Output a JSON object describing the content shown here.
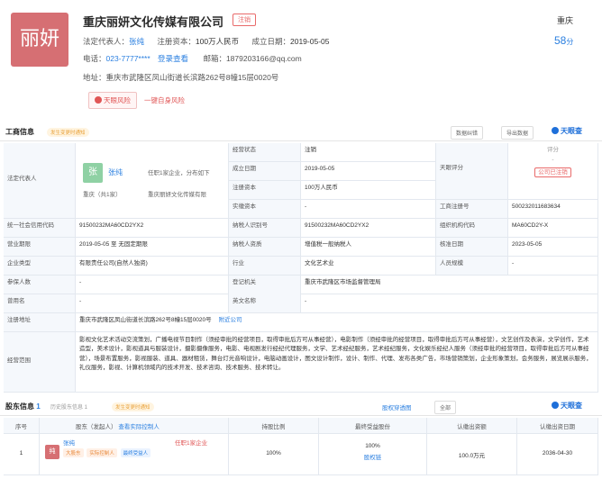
{
  "header": {
    "logo_text": "丽妍",
    "company_name": "重庆丽妍文化传媒有限公司",
    "status": "注销",
    "legal_label": "法定代表人：",
    "legal_name": "张纯",
    "capital_label": "注册资本：",
    "capital": "100万人民币",
    "date_label": "成立日期：",
    "date": "2019-05-05",
    "phone_label": "电话：",
    "phone": "023-7777****",
    "login_view": "登录查看",
    "email_label": "邮箱：",
    "email": "1879203166@qq.com",
    "address_label": "地址：",
    "address": "重庆市武隆区凤山街道长滨路262号8幢15层0020号",
    "risk_btn": "天眼风险",
    "self_check": "一键自身风险",
    "city": "重庆",
    "score": "58",
    "score_unit": "分"
  },
  "business": {
    "title": "工商信息",
    "badge": "发生变更时通知",
    "export_btn": "数据纠错",
    "download_btn": "导出数据",
    "brand": "天眼查",
    "legal_rep_label": "法定代表人",
    "legal_avatar": "张",
    "legal_name": "张纯",
    "legal_note": "任职1家企业，分布如下",
    "legal_region": "重庆（共1家）",
    "legal_company": "重庆丽妍文化传媒有限",
    "status_label": "经营状态",
    "status_value": "注销",
    "found_label": "成立日期",
    "found_value": "2019-05-05",
    "capital_label": "注册资本",
    "capital_value": "100万人民币",
    "paid_label": "实缴资本",
    "paid_value": "-",
    "tianyan_label": "天眼评分",
    "score_label": "评分",
    "score_dash": "-",
    "cancel_tag": "公司已注销",
    "reg_no_label": "工商注册号",
    "reg_no_value": "500232011683634",
    "credit_label": "统一社会信用代码",
    "credit_value": "91500232MA60CD2YX2",
    "tax_label": "纳税人识别号",
    "tax_value": "91500232MA60CD2YX2",
    "org_label": "组织机构代码",
    "org_value": "MA60CD2Y-X",
    "term_label": "营业期限",
    "term_value": "2019-05-05 至 无固定期限",
    "taxpayer_label": "纳税人资质",
    "taxpayer_value": "增值税一般纳税人",
    "approve_label": "核准日期",
    "approve_value": "2023-05-05",
    "type_label": "企业类型",
    "type_value": "有限责任公司(自然人独资)",
    "industry_label": "行业",
    "industry_value": "文化艺术业",
    "staff_label": "人员规模",
    "staff_value": "-",
    "insured_label": "参保人数",
    "insured_value": "-",
    "authority_label": "登记机关",
    "authority_value": "重庆市武隆区市场监督管理局",
    "former_label": "曾用名",
    "former_value": "-",
    "en_label": "英文名称",
    "en_value": "-",
    "addr_label": "注册地址",
    "addr_value": "重庆市武隆区凤山街道长滨路262号8幢15层0020号",
    "nearby": "附近公司",
    "scope_label": "经营范围",
    "scope_value": "影视文化艺术活动交流策划，广播电视节目制作（须经审批的经营项目，取得审批后方可从事经营），电影制作（须经审批的经营项目，取得审批后方可从事经营），文艺创作及表演，文学创作，艺术造型，美术设计，影视道具与服装设计，摄影摄像服务，电影、电视剧发行经纪代理服务，文学、艺术经纪服务，艺术经纪服务，文化娱乐经纪人服务（须经审批的经营项目，取得审批后方可从事经营），场景布置服务，影视服装、道具、器材租赁，舞台灯光音响设计，电脑动画设计，图文设计制作，设计、制作、代理、发布各类广告，市场营销策划，企业形象策划，会务服务，展览展示服务，礼仪服务，影视、计算机领域内的技术开发、技术咨询、技术服务、技术转让。"
  },
  "shareholders": {
    "title": "股东信息",
    "count": "1",
    "history": "历史股东信息 1",
    "badge": "发生变更时通知",
    "structure": "股权穿透图",
    "all_btn": "全部",
    "brand": "天眼查",
    "col_no": "序号",
    "col_name": "股东（发起人）",
    "col_actual": "查看实际控制人",
    "col_ratio": "持股比例",
    "col_final": "最终受益股份",
    "col_paid": "认缴出资额",
    "col_date": "认缴出资日期",
    "row_no": "1",
    "row_avatar": "纯",
    "row_name": "张纯",
    "row_tag1": "大股东",
    "row_tag2": "实际控制人",
    "row_tag3": "最终受益人",
    "row_jobs": "任职1家企业",
    "row_ratio": "100%",
    "row_final": "100%",
    "row_path": "股权链",
    "row_paid": "100.0万元",
    "row_date": "2036-04-30"
  }
}
